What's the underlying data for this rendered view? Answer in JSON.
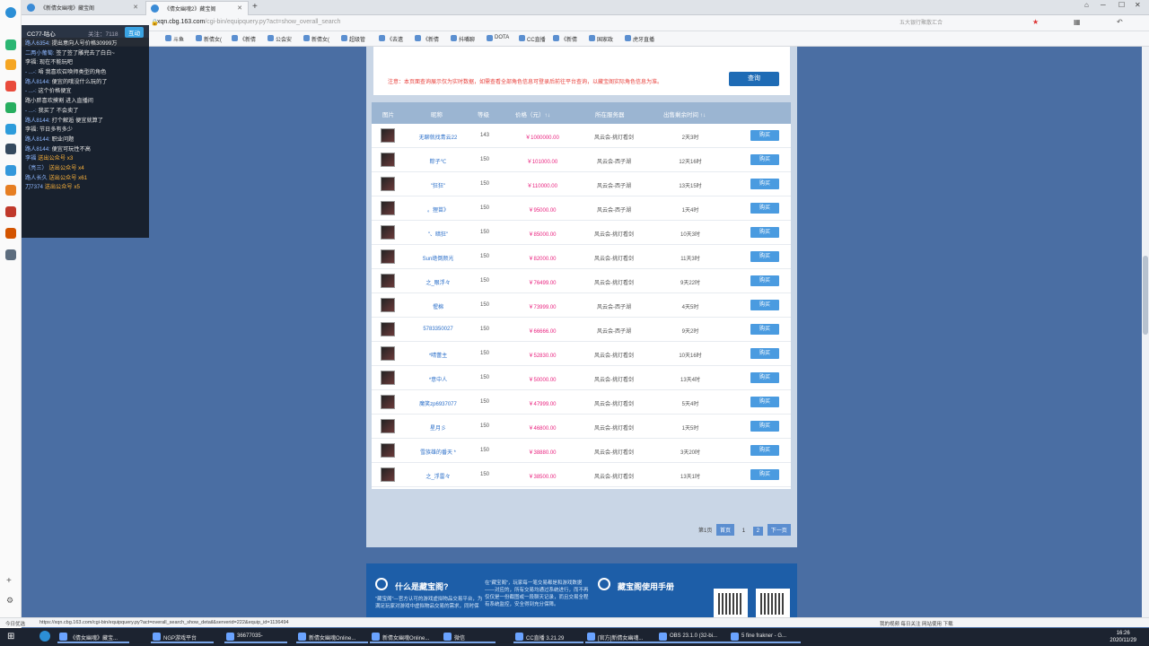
{
  "browser": {
    "tabs": [
      {
        "label": "《新倩女幽魂》藏宝阁",
        "active": false
      },
      {
        "label": "《倩女幽魂2》藏宝阁",
        "active": true
      }
    ],
    "url": "xqn.cbg.163.com",
    "url_tail": "/cgi-bin/equipquery.py?act=show_overall_search",
    "search_placeholder": "五大银行聚散汇合",
    "bookmarks": [
      "斗鱼",
      "新倩女(",
      "《新倩",
      "公会安",
      "新倩女(",
      "超级管",
      "《去遗",
      "《新倩",
      "抖嘴聊",
      "DOTA",
      "CC直播",
      "《新倩",
      "国家政",
      "虎牙直播"
    ]
  },
  "chat": {
    "room": "CC77-咕心",
    "fans": "关注：7118",
    "follow_label": "互动",
    "lines": [
      {
        "user": "路人6354:",
        "text": "提出意向人号价格30999万"
      },
      {
        "user": "二两小葡萄:",
        "text": "签了签了雕兜去了白白~"
      },
      {
        "user": "",
        "text": "李福:  现在不能玩吧"
      },
      {
        "user": "- ...-:",
        "text": "唔 我喜欢召唤师类型的角色"
      },
      {
        "user": "路人8144:",
        "text": "便宜的哦没什么玩的了"
      },
      {
        "user": "- ...-:",
        "text": "这个价格便宜"
      },
      {
        "user": "",
        "text": "路小胖喜欢摸割 进入直播间"
      },
      {
        "user": "- ...-:",
        "text": "我买了 不会卖了"
      },
      {
        "user": "路人8144:",
        "text": "打个解逅 便宜就算了"
      },
      {
        "user": "",
        "text": "李福:  节日多有多少"
      },
      {
        "user": "路人8144:",
        "text": "职业问题"
      },
      {
        "user": "路人8144:",
        "text": "便宜可玩性不高"
      },
      {
        "user": "李福",
        "text": "送出公众号 x3",
        "gift": true
      },
      {
        "user": "（亮三）",
        "text": "送出公众号 x4",
        "gift": true
      },
      {
        "user": "路人长久",
        "text": "送出公众号 x61",
        "gift": true
      },
      {
        "user": "刀7374",
        "text": "送出公众号 x5",
        "gift": true
      }
    ]
  },
  "search": {
    "notice": "注意：本页面查询展示仅为实时数据，如需查看全部角色信息可登录后前往平台查询，以藏宝阁实际角色信息为准。",
    "query_button": "查询"
  },
  "table": {
    "headers": [
      "图片",
      "昵称",
      "等级",
      "价格（元）↑↓",
      "所在服务器",
      "出售剩余时间 ↑↓"
    ],
    "buy_label": "购买",
    "rows": [
      {
        "name": "无聊就找青云22",
        "level": "143",
        "price": "￥1000000.00",
        "server": "风云会-挑灯看剑",
        "time": "2天3时"
      },
      {
        "name": "粽子℃",
        "level": "150",
        "price": "￥101000.00",
        "server": "风云会-西子湖",
        "time": "12天16时"
      },
      {
        "name": "\"狂狂\"",
        "level": "150",
        "price": "￥110000.00",
        "server": "风云会-西子湖",
        "time": "13天15时"
      },
      {
        "name": "。狸苗》",
        "level": "150",
        "price": "￥95000.00",
        "server": "风云会-西子湖",
        "time": "1天4时"
      },
      {
        "name": "\"、暗狂\"",
        "level": "150",
        "price": "￥85000.00",
        "server": "风云会-挑灯看剑",
        "time": "10天3时"
      },
      {
        "name": "Sun绝倒颜光",
        "level": "150",
        "price": "￥82000.00",
        "server": "风云会-挑灯看剑",
        "time": "11天3时"
      },
      {
        "name": "之_眼浮々",
        "level": "150",
        "price": "￥76499.00",
        "server": "风云会-挑灯看剑",
        "time": "9天22时"
      },
      {
        "name": "惺棉",
        "level": "150",
        "price": "￥73999.00",
        "server": "风云会-西子湖",
        "time": "4天5时"
      },
      {
        "name": "5783350027",
        "level": "150",
        "price": "￥66666.00",
        "server": "风云会-西子湖",
        "time": "9天2时"
      },
      {
        "name": "*晴蕾主",
        "level": "150",
        "price": "￥52830.00",
        "server": "风云会-挑灯看剑",
        "time": "10天16时"
      },
      {
        "name": "*意中人",
        "level": "150",
        "price": "￥50000.00",
        "server": "风云会-挑灯看剑",
        "time": "13天4时"
      },
      {
        "name": "魔笑zp6937077",
        "level": "150",
        "price": "￥47999.00",
        "server": "风云会-挑灯看剑",
        "time": "5天4时"
      },
      {
        "name": "星月彡",
        "level": "150",
        "price": "￥46800.00",
        "server": "风云会-挑灯看剑",
        "time": "1天5时"
      },
      {
        "name": "雪族雄的番天 *",
        "level": "150",
        "price": "￥38880.00",
        "server": "风云会-挑灯看剑",
        "time": "3天20时"
      },
      {
        "name": "之_浮雷々",
        "level": "150",
        "price": "￥38500.00",
        "server": "风云会-挑灯看剑",
        "time": "13天1时"
      }
    ]
  },
  "pager": {
    "first": "第1页",
    "prev": "首页",
    "p1": "1",
    "p2": "2",
    "next": "下一页"
  },
  "footer": {
    "what_title": "什么是藏宝阁?",
    "what_text": "\"藏宝阁\"—官方认可的游戏虚拟物品交易平台，为满足玩家对游戏中虚拟物品交易的需求，同时保",
    "what_text2": "在\"藏宝阁\"，玩家每一笔交易都是和游戏数据——对应的，所有交易均通过系统进行，而不再仅仅是一份截图或一段聊天记录，而且交易全程有系统监控，安全得到充分保障。",
    "manual_title": "藏宝阁使用手册"
  },
  "statusbar": {
    "left": "今日优选",
    "url": "https://xqn.cbg.163.com/cgi-bin/equipquery.py?act=overall_search_show_detail&serverid=222&equip_id=1136494",
    "right": "我的视频  每日关注  网站使用  下载"
  },
  "taskbar": {
    "items": [
      "《倩女幽魂》藏宝...",
      "NGP游戏平台",
      "36677035-",
      "新倩女幽魂Online...",
      "新倩女幽魂Online...",
      "微信",
      "CC直播 3.21.29",
      "[官方]新倩女幽魂...",
      "OBS 23.1.0 (32-bi...",
      "5 fine frakner - G..."
    ],
    "time": "16:26",
    "date": "2020/11/29"
  }
}
